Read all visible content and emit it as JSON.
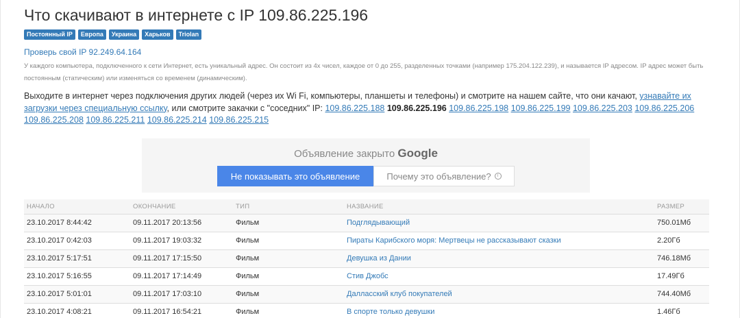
{
  "title": "Что скачивают в интернете с IP 109.86.225.196",
  "tags": [
    "Постоянный IP",
    "Европа",
    "Украина",
    "Харьков",
    "Triolan"
  ],
  "check_ip": "Проверь свой IP 92.249.64.164",
  "ip_info": "У каждого компьютера, подключенного к сети Интернет, есть уникальный адрес. Он состоит из 4х чисел, каждое от 0 до 255, разделенных точками (например 175.204.122.239), и называется IP адресом. IP адрес может быть постоянным (статическим) или изменяться со временем (динамическим).",
  "intro": {
    "text_before": "Выходите в интернет через подключения других людей (через их Wi Fi, компьютеры, планшеты и телефоны) и смотрите на нашем сайте, что они качают, ",
    "link": "узнавайте их загрузки через специальную ссылку",
    "text_after": ", или смотрите закачки с \"соседних\" IP: ",
    "neighbor_ips": [
      "109.86.225.188",
      "109.86.225.196",
      "109.86.225.198",
      "109.86.225.199",
      "109.86.225.203",
      "109.86.225.206",
      "109.86.225.208",
      "109.86.225.211",
      "109.86.225.214",
      "109.86.225.215"
    ],
    "current_ip": "109.86.225.196"
  },
  "ad": {
    "closed_text": "Объявление закрыто",
    "brand": "Google",
    "hide_button": "Не показывать это объявление",
    "why_button": "Почему это объявление?",
    "info_glyph": "i"
  },
  "table": {
    "headers": [
      "НАЧАЛО",
      "ОКОНЧАНИЕ",
      "ТИП",
      "НАЗВАНИЕ",
      "РАЗМЕР"
    ],
    "rows": [
      [
        "23.10.2017 8:44:42",
        "09.11.2017 20:13:56",
        "Фильм",
        "Подглядывающий",
        "750.01Мб"
      ],
      [
        "23.10.2017 0:42:03",
        "09.11.2017 19:03:32",
        "Фильм",
        "Пираты Карибского моря: Мертвецы не рассказывают сказки",
        "2.20Гб"
      ],
      [
        "23.10.2017 5:17:51",
        "09.11.2017 17:15:50",
        "Фильм",
        "Девушка из Дании",
        "746.18Мб"
      ],
      [
        "23.10.2017 5:16:55",
        "09.11.2017 17:14:49",
        "Фильм",
        "Стив Джобс",
        "17.49Гб"
      ],
      [
        "23.10.2017 5:01:01",
        "09.11.2017 17:03:10",
        "Фильм",
        "Далласский клуб покупателей",
        "744.40Мб"
      ],
      [
        "23.10.2017 4:08:21",
        "09.11.2017 16:54:21",
        "Фильм",
        "В спорте только девушки",
        "1.46Гб"
      ]
    ]
  },
  "colors": {
    "link": "#337ab7",
    "tag_bg": "#337ab7",
    "ad_button": "#4a86e8"
  }
}
